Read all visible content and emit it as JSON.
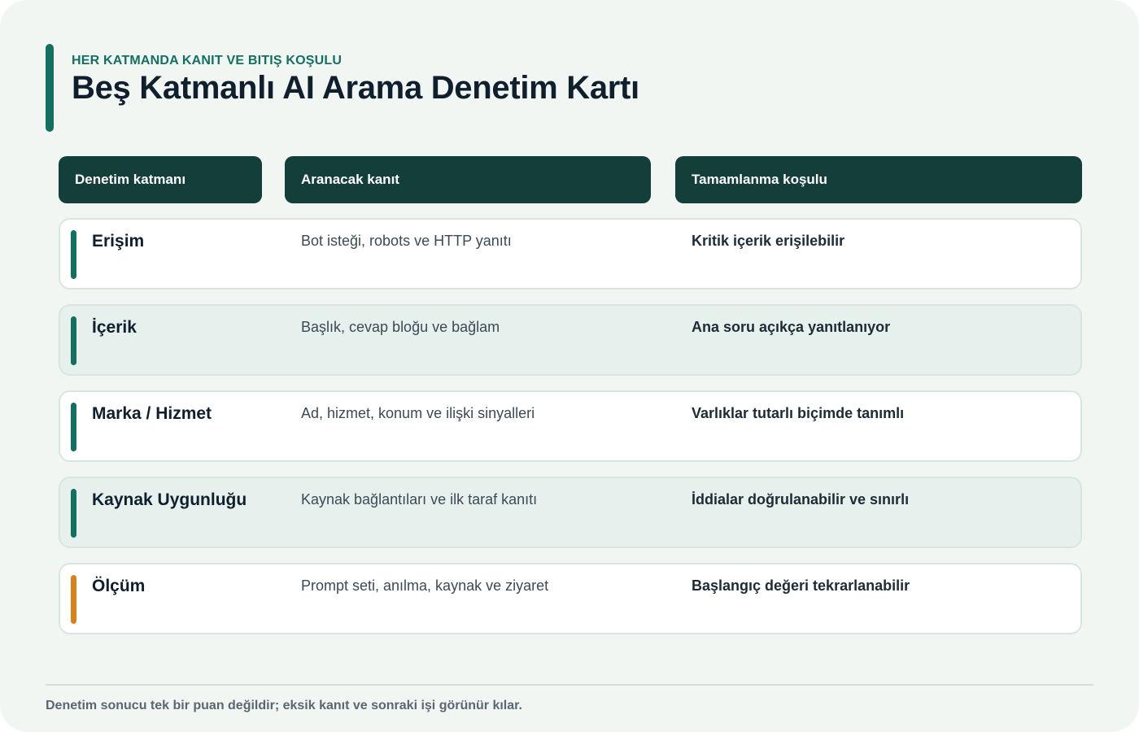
{
  "header": {
    "eyebrow": "HER KATMANDA KANIT VE BITIŞ KOŞULU",
    "title": "Beş Katmanlı AI Arama Denetim Kartı"
  },
  "table": {
    "columns": [
      "Denetim katmanı",
      "Aranacak kanıt",
      "Tamamlanma koşulu"
    ],
    "rows": [
      {
        "layer": "Erişim",
        "evidence": "Bot isteği, robots ve HTTP yanıtı",
        "condition": "Kritik içerik erişilebilir",
        "accent_color": "#137060"
      },
      {
        "layer": "İçerik",
        "evidence": "Başlık, cevap bloğu ve bağlam",
        "condition": "Ana soru açıkça yanıtlanıyor",
        "accent_color": "#137060"
      },
      {
        "layer": "Marka / Hizmet",
        "evidence": "Ad, hizmet, konum ve ilişki sinyalleri",
        "condition": "Varlıklar tutarlı biçimde tanımlı",
        "accent_color": "#137060"
      },
      {
        "layer": "Kaynak Uygunluğu",
        "evidence": "Kaynak bağlantıları ve ilk taraf kanıtı",
        "condition": "İddialar doğrulanabilir ve sınırlı",
        "accent_color": "#137060"
      },
      {
        "layer": "Ölçüm",
        "evidence": "Prompt seti, anılma, kaynak ve ziyaret",
        "condition": "Başlangıç değeri tekrarlanabilir",
        "accent_color": "#d9821a"
      }
    ]
  },
  "footer": {
    "note": "Denetim sonucu tek bir puan değildir; eksik kanıt ve sonraki işi görünür kılar."
  },
  "colors": {
    "primary": "#137060",
    "header_bg": "#133e3a",
    "highlight": "#d9821a",
    "card_bg": "#f1f6f3"
  }
}
